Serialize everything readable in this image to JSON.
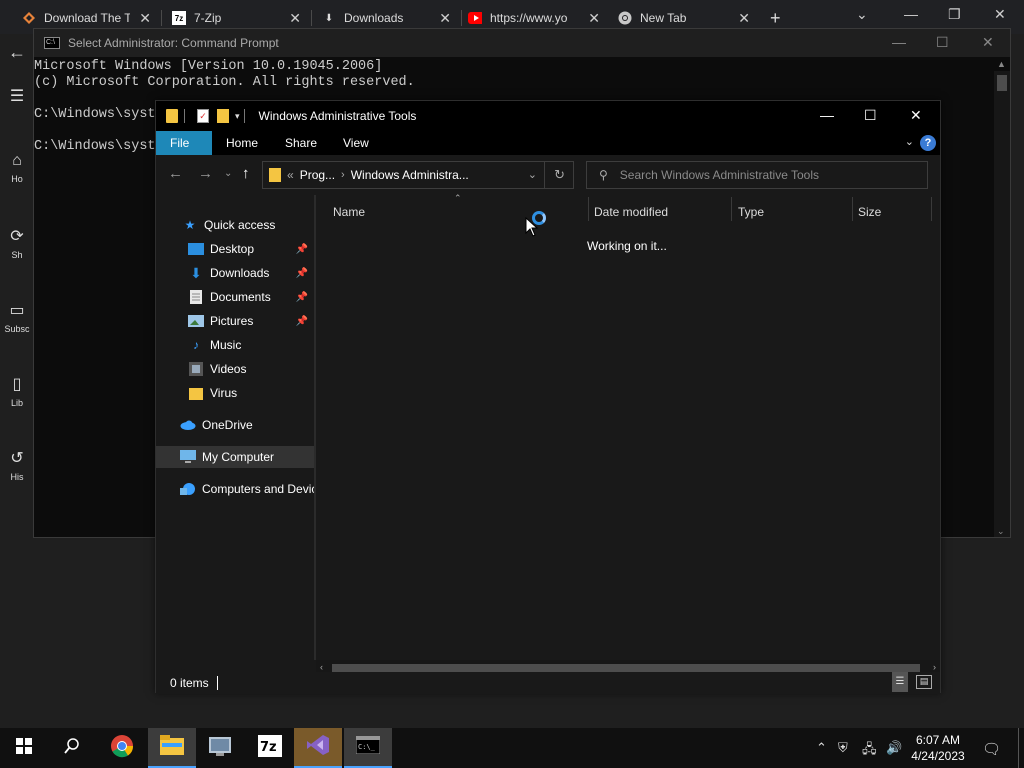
{
  "browser": {
    "tabs": [
      {
        "label": "Download The T",
        "icon": "download-site-icon"
      },
      {
        "label": "7-Zip",
        "icon": "7zip-icon"
      },
      {
        "label": "Downloads",
        "icon": "download-icon"
      },
      {
        "label": "https://www.yo",
        "icon": "youtube-icon"
      },
      {
        "label": "New Tab",
        "icon": "chrome-icon"
      }
    ],
    "new_tab": "+",
    "rail_items": [
      {
        "label": "Ho"
      },
      {
        "label": "Sh"
      },
      {
        "label": "Subsc"
      },
      {
        "label": "Lib"
      },
      {
        "label": "His"
      }
    ]
  },
  "cmd": {
    "title": "Select Administrator: Command Prompt",
    "lines": [
      "Microsoft Windows [Version 10.0.19045.2006]",
      "(c) Microsoft Corporation. All rights reserved.",
      "",
      "C:\\Windows\\syst",
      "",
      "C:\\Windows\\syst"
    ]
  },
  "explorer": {
    "title": "Windows Administrative Tools",
    "ribbon_tabs": [
      "File",
      "Home",
      "Share",
      "View"
    ],
    "help": "?",
    "address": {
      "prefix": "«",
      "segments": [
        "Prog...",
        "Windows Administra..."
      ]
    },
    "search_placeholder": "Search Windows Administrative Tools",
    "nav_items": [
      {
        "label": "Quick access",
        "icon": "star-icon",
        "pinned": false
      },
      {
        "label": "Desktop",
        "icon": "desktop-icon",
        "pinned": true
      },
      {
        "label": "Downloads",
        "icon": "download-arrow-icon",
        "pinned": true
      },
      {
        "label": "Documents",
        "icon": "document-icon",
        "pinned": true
      },
      {
        "label": "Pictures",
        "icon": "pictures-icon",
        "pinned": true
      },
      {
        "label": "Music",
        "icon": "music-icon",
        "pinned": false
      },
      {
        "label": "Videos",
        "icon": "video-icon",
        "pinned": false
      },
      {
        "label": "Virus",
        "icon": "folder-icon",
        "pinned": false
      },
      {
        "label": "OneDrive",
        "icon": "cloud-icon",
        "pinned": false
      },
      {
        "label": "My Computer",
        "icon": "computer-icon",
        "pinned": false
      },
      {
        "label": "Computers and Devices",
        "icon": "network-icon",
        "pinned": false
      }
    ],
    "columns": [
      "Name",
      "Date modified",
      "Type",
      "Size"
    ],
    "loading_text": "Working on it...",
    "status": "0 items"
  },
  "taskbar": {
    "apps": [
      {
        "name": "chrome",
        "icon": "chrome-icon"
      },
      {
        "name": "file-explorer",
        "icon": "folder-icon"
      },
      {
        "name": "control-panel",
        "icon": "control-panel-icon"
      },
      {
        "name": "7zip",
        "icon": "7zip-icon"
      },
      {
        "name": "visual-studio",
        "icon": "visual-studio-icon"
      },
      {
        "name": "command-prompt",
        "icon": "terminal-icon"
      }
    ],
    "time": "6:07 AM",
    "date": "4/24/2023"
  },
  "colors": {
    "accent": "#1e88b8",
    "folder": "#f4c542",
    "spinner": "#2f8fe0"
  }
}
